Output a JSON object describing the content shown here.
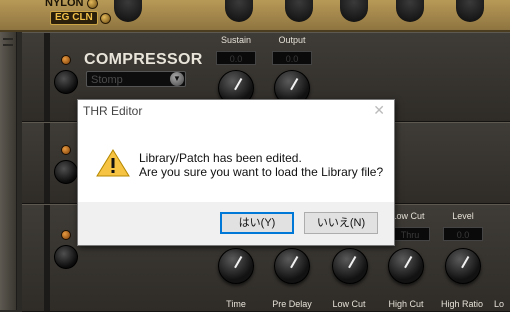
{
  "amp_strip": {
    "amp_name": "NYLON",
    "badge": "EG CLN"
  },
  "compressor": {
    "title": "COMPRESSOR",
    "type_value": "Stomp",
    "params": [
      {
        "label": "Sustain",
        "value": "0.0"
      },
      {
        "label": "Output",
        "value": "0.0"
      }
    ]
  },
  "reverb": {
    "header_params": [
      {
        "label": "Low Cut",
        "value": "Thru"
      },
      {
        "label": "Level",
        "value": "0.0"
      }
    ],
    "knob_labels": [
      "Time",
      "Pre Delay",
      "Low Cut",
      "High Cut",
      "High Ratio",
      "Lo"
    ]
  },
  "dialog": {
    "title": "THR Editor",
    "close_glyph": "✕",
    "line1": "Library/Patch has been edited.",
    "line2": "Are you sure you want to load the Library file?",
    "yes_label": "はい(Y)",
    "no_label": "いいえ(N)",
    "icon": "warning-icon"
  },
  "colors": {
    "gold_strip": "#b89a57",
    "led_orange": "#e99a40",
    "dialog_default_border": "#0078d7"
  }
}
